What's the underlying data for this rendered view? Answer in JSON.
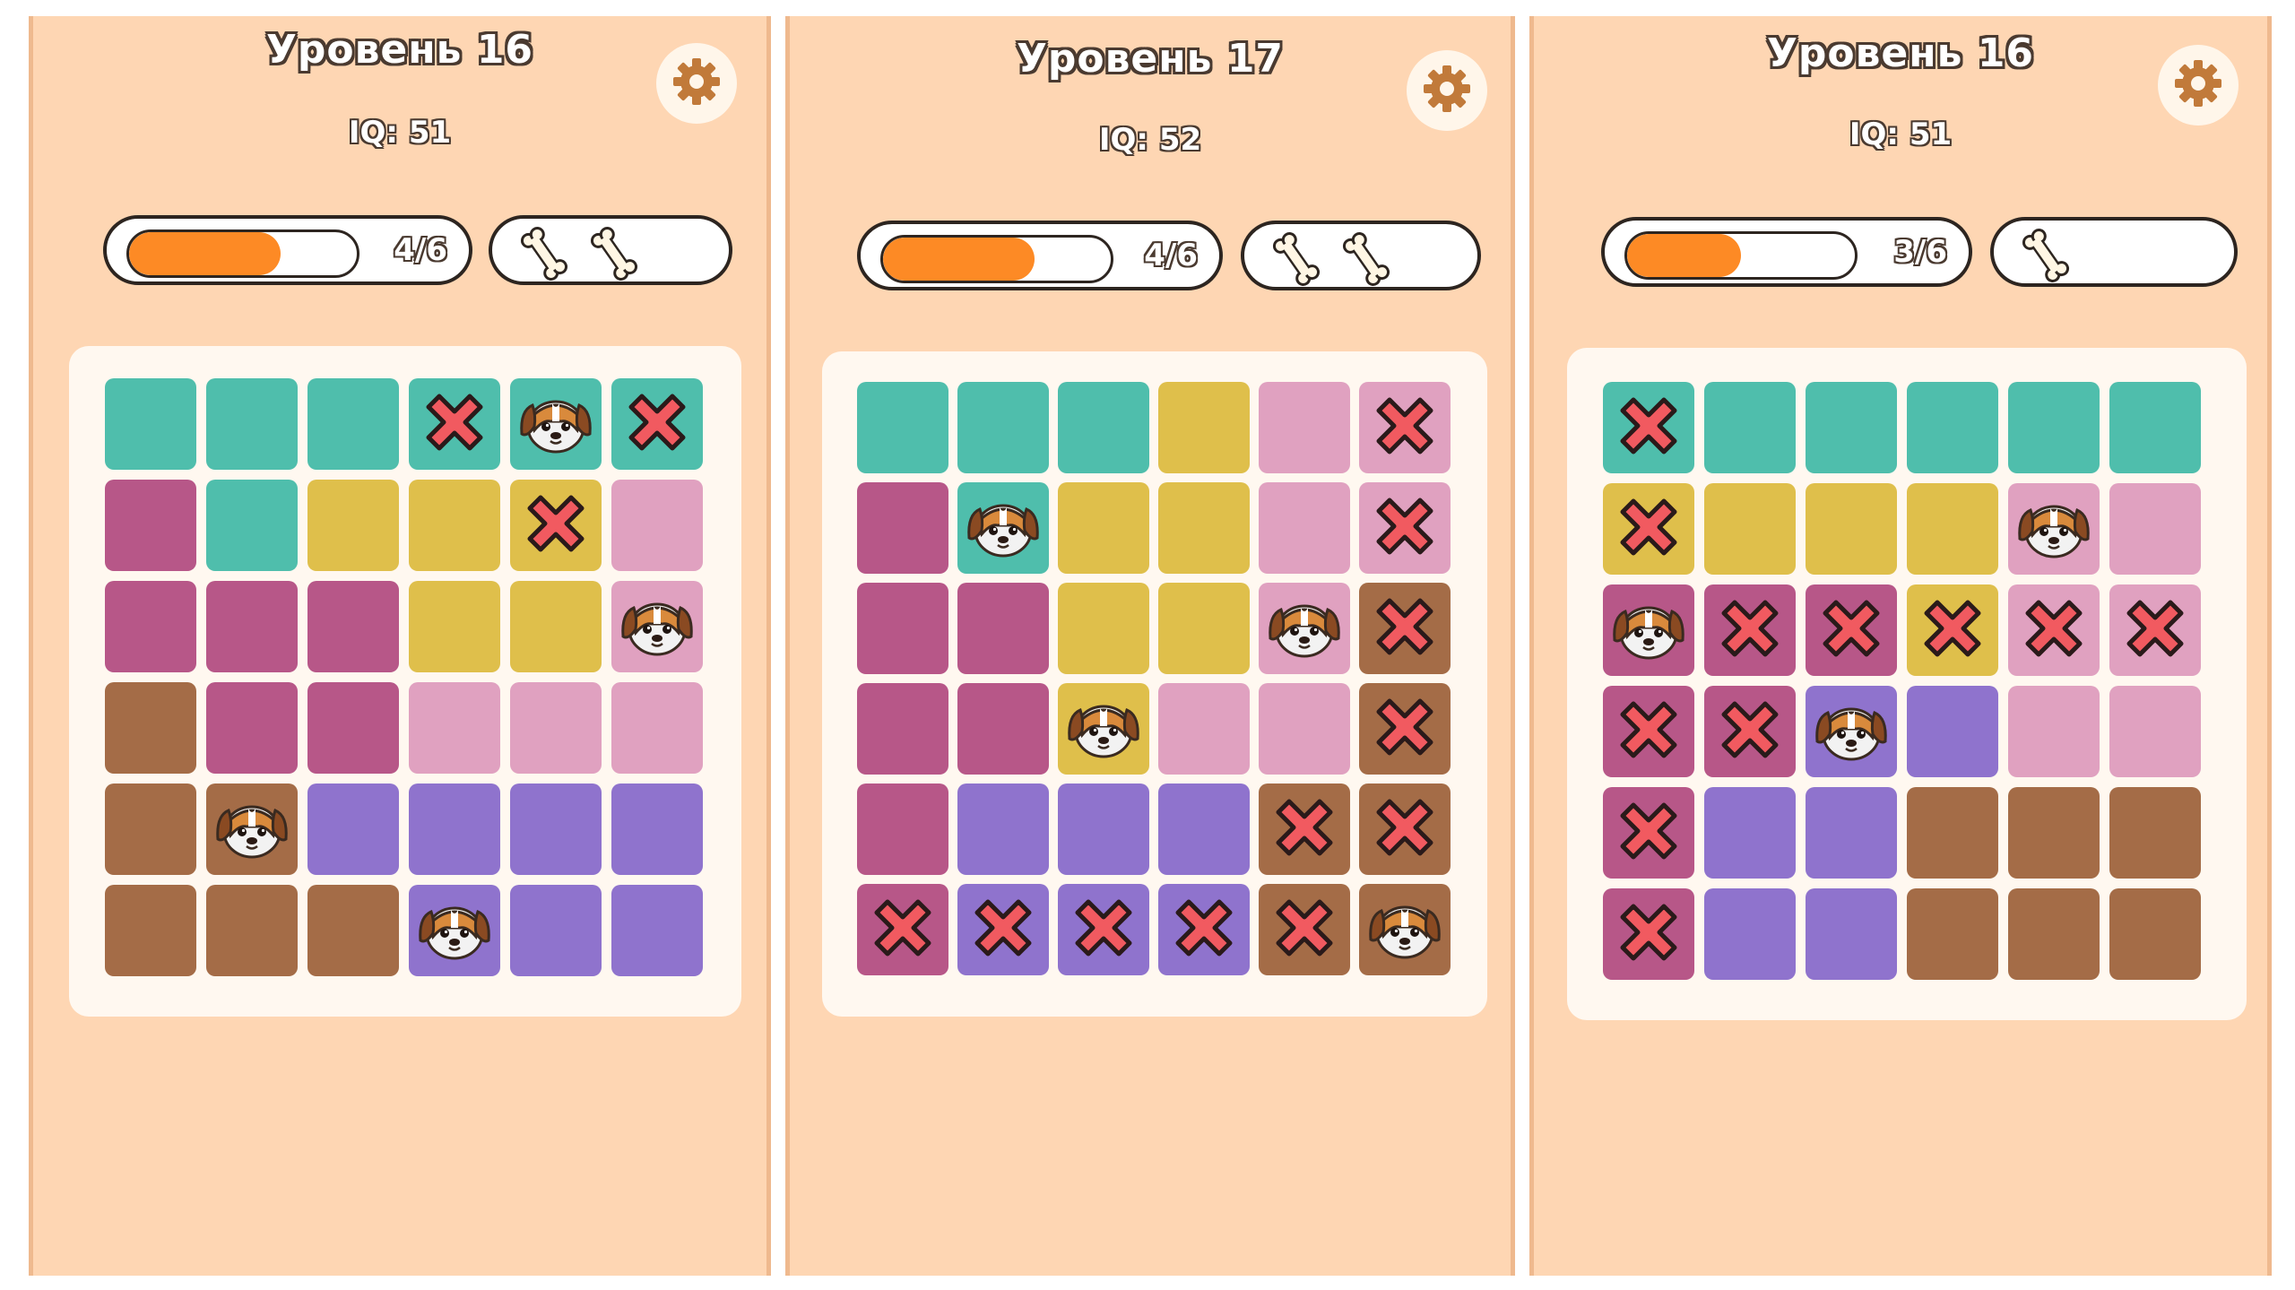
{
  "palette": {
    "T": "#4fbeac",
    "M": "#b75788",
    "Y": "#dfbf4b",
    "P": "#e0a1c0",
    "B": "#a46c47",
    "V": "#8f73cd"
  },
  "panels": [
    {
      "title": "Уровень 16",
      "iq": "IQ: 51",
      "progress_label": "4/6",
      "progress": 0.667,
      "bones": 2,
      "colors": [
        "TTTTTT",
        "MTYYYP",
        "MMMYYP",
        "BMMPPP",
        "BBVVVV",
        "BBBVVV"
      ],
      "marks": [
        "...XDX",
        "....X.",
        ".....D",
        "......",
        ".D....",
        "...D.."
      ]
    },
    {
      "title": "Уровень 17",
      "iq": "IQ: 52",
      "progress_label": "4/6",
      "progress": 0.667,
      "bones": 2,
      "colors": [
        "TTTYPP",
        "MTYYPP",
        "MMYYPB",
        "MMYPPB",
        "MVVVBB",
        "MVVVBB"
      ],
      "marks": [
        ".....X",
        ".D...X",
        "....DX",
        "..D..X",
        "....XX",
        "XXXXXD"
      ]
    },
    {
      "title": "Уровень 16",
      "iq": "IQ: 51",
      "progress_label": "3/6",
      "progress": 0.5,
      "bones": 1,
      "colors": [
        "TTTTTT",
        "YYYYPP",
        "MMMYPP",
        "MMVVPP",
        "MVVBBB",
        "MVVBBB"
      ],
      "marks": [
        "X.....",
        "X...D.",
        "DXXXXX",
        "XXD...",
        "X.....",
        "X....."
      ]
    }
  ]
}
